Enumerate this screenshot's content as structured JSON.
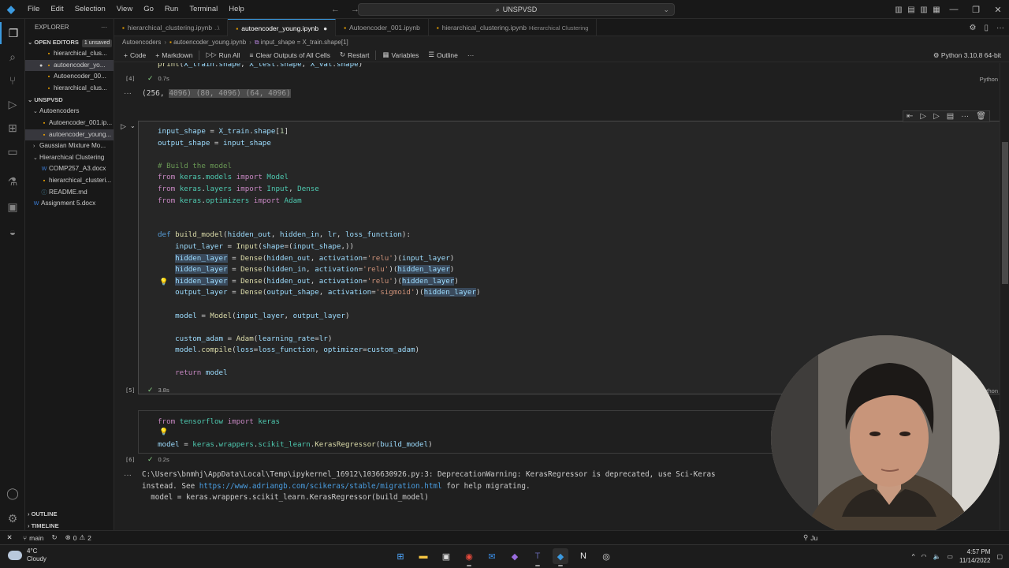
{
  "menu": [
    "File",
    "Edit",
    "Selection",
    "View",
    "Go",
    "Run",
    "Terminal",
    "Help"
  ],
  "search": {
    "text": "UNSPVSD"
  },
  "explorer": {
    "title": "EXPLORER",
    "open_editors": {
      "label": "OPEN EDITORS",
      "badge": "1 unsaved"
    },
    "open_files": [
      "hierarchical_clus...",
      "autoencoder_yo...",
      "Autoencoder_00...",
      "hierarchical_clus..."
    ],
    "workspace": "UNSPVSD",
    "tree": [
      {
        "label": "Autoencoders",
        "type": "folder",
        "indent": 1
      },
      {
        "label": "Autoencoder_001.ip...",
        "type": "nb",
        "indent": 2
      },
      {
        "label": "autoencoder_young...",
        "type": "nb",
        "indent": 2
      },
      {
        "label": "Gaussian Mixture Mo...",
        "type": "folder-closed",
        "indent": 1
      },
      {
        "label": "Hierarchical Clustering",
        "type": "folder",
        "indent": 1
      },
      {
        "label": "COMP257_A3.docx",
        "type": "doc",
        "indent": 2
      },
      {
        "label": "hierarchical_clusteri...",
        "type": "nb",
        "indent": 2
      },
      {
        "label": "README.md",
        "type": "md",
        "indent": 2
      },
      {
        "label": "Assignment 5.docx",
        "type": "doc",
        "indent": 1
      }
    ],
    "outline": "OUTLINE",
    "timeline": "TIMELINE"
  },
  "tabs": [
    {
      "label": "hierarchical_clustering.ipynb",
      "suffix": "..\\"
    },
    {
      "label": "autoencoder_young.ipynb",
      "dirty": "●"
    },
    {
      "label": "Autoencoder_001.ipynb"
    },
    {
      "label": "hierarchical_clustering.ipynb",
      "desc": "Hierarchical Clustering"
    }
  ],
  "breadcrumb": [
    "Autoencoders",
    "autoencoder_young.ipynb",
    "input_shape = X_train.shape[1]"
  ],
  "toolbar": {
    "code": "Code",
    "markdown": "Markdown",
    "run_all": "Run All",
    "clear": "Clear Outputs of All Cells",
    "restart": "Restart",
    "variables": "Variables",
    "outline": "Outline",
    "more": "···"
  },
  "kernel": "Python 3.10.8 64-bit",
  "cells": {
    "prev": {
      "top_code": "print(X_train.shape, X_test.shape, X_val.shape)",
      "exec": "[4]",
      "time": "0.7s",
      "lang": "Python",
      "output_plain": "(256, ",
      "output_sel": "4096) (80, 4096) (64, 4096)"
    },
    "current": {
      "exec": "[5]",
      "time": "3.8s",
      "lang": "Python"
    },
    "next": {
      "exec": "[6]",
      "time": "0.2s",
      "output_line1": "C:\\Users\\bnmhj\\AppData\\Local\\Temp\\ipykernel_16912\\1036630926.py:3: DeprecationWarning: KerasRegressor is deprecated, use Sci-Keras",
      "output_line2_pre": "instead. See ",
      "output_link": "https://www.adriangb.com/scikeras/stable/migration.html",
      "output_line2_post": " for help migrating.",
      "output_line3": "  model = keras.wrappers.scikit_learn.KerasRegressor(build_model)"
    }
  },
  "statusbar": {
    "branch": "main",
    "errors": "0",
    "warnings": "2",
    "right": "Ju"
  },
  "taskbar": {
    "temp": "4°C",
    "weather": "Cloudy",
    "time": "4:57 PM",
    "date": "11/14/2022"
  }
}
